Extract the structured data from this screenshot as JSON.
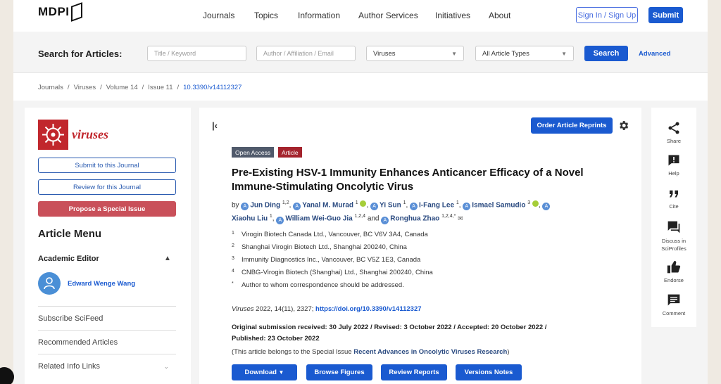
{
  "header": {
    "logo": "MDPI",
    "nav": [
      "Journals",
      "Topics",
      "Information",
      "Author Services",
      "Initiatives",
      "About"
    ],
    "signin_label": "Sign In / Sign Up",
    "submit_label": "Submit"
  },
  "search": {
    "label": "Search for Articles:",
    "title_placeholder": "Title / Keyword",
    "author_placeholder": "Author / Affiliation / Email",
    "journal_selected": "Viruses",
    "type_selected": "All Article Types",
    "search_label": "Search",
    "advanced_label": "Advanced"
  },
  "breadcrumb": [
    "Journals",
    "Viruses",
    "Volume 14",
    "Issue 11",
    "10.3390/v14112327"
  ],
  "sidebar": {
    "journal_name": "viruses",
    "submit_btn": "Submit to this Journal",
    "review_btn": "Review for this Journal",
    "propose_btn": "Propose a Special Issue",
    "menu_title": "Article Menu",
    "academic_editor_title": "Academic Editor",
    "editor_name": "Edward Wenge Wang",
    "rows": [
      "Subscribe SciFeed",
      "Recommended Articles",
      "Related Info Links"
    ]
  },
  "article": {
    "reprints_label": "Order Article Reprints",
    "tags": [
      "Open Access",
      "Article"
    ],
    "title": "Pre-Existing HSV-1 Immunity Enhances Anticancer Efficacy of a Novel Immune-Stimulating Oncolytic Virus",
    "by": "by",
    "authors": [
      {
        "name": "Jun Ding",
        "sup": "1,2"
      },
      {
        "name": "Yanal M. Murad",
        "sup": "1"
      },
      {
        "name": "Yi Sun",
        "sup": "1"
      },
      {
        "name": "I-Fang Lee",
        "sup": "1"
      },
      {
        "name": "Ismael Samudio",
        "sup": "3"
      },
      {
        "name": "Xiaohu Liu",
        "sup": "1"
      },
      {
        "name": "William Wei-Guo Jia",
        "sup": "1,2,4"
      },
      {
        "name": "Ronghua Zhao",
        "sup": "1,2,4,*"
      }
    ],
    "and_word": "and",
    "affiliations": [
      {
        "num": "1",
        "text": "Virogin Biotech Canada Ltd., Vancouver, BC V6V 3A4, Canada"
      },
      {
        "num": "2",
        "text": "Shanghai Virogin Biotech Ltd., Shanghai 200240, China"
      },
      {
        "num": "3",
        "text": "Immunity Diagnostics Inc., Vancouver, BC V5Z 1E3, Canada"
      },
      {
        "num": "4",
        "text": "CNBG-Virogin Biotech (Shanghai) Ltd., Shanghai 200240, China"
      },
      {
        "num": "*",
        "text": "Author to whom correspondence should be addressed."
      }
    ],
    "citation_journal": "Viruses",
    "citation_rest": " 2022, 14(11), 2327; ",
    "citation_doi": "https://doi.org/10.3390/v14112327",
    "dates_line1": "Original submission received: 30 July 2022 / Revised: 3 October 2022 / Accepted: 20 October 2022 /",
    "dates_line2": "Published: 23 October 2022",
    "special_prefix": "(This article belongs to the Special Issue ",
    "special_name": "Recent Advances in Oncolytic Viruses Research",
    "special_suffix": ")",
    "actions": [
      "Download",
      "Browse Figures",
      "Review Reports",
      "Versions Notes"
    ]
  },
  "rightbar": [
    "Share",
    "Help",
    "Cite",
    "Discuss in SciProfiles",
    "Endorse",
    "Comment"
  ],
  "colors": {
    "brand_blue": "#1a5ad0",
    "journal_red": "#c1272d",
    "propose_red": "#c9505a",
    "tag_gray": "#505a6b",
    "tag_red": "#a4232c"
  }
}
